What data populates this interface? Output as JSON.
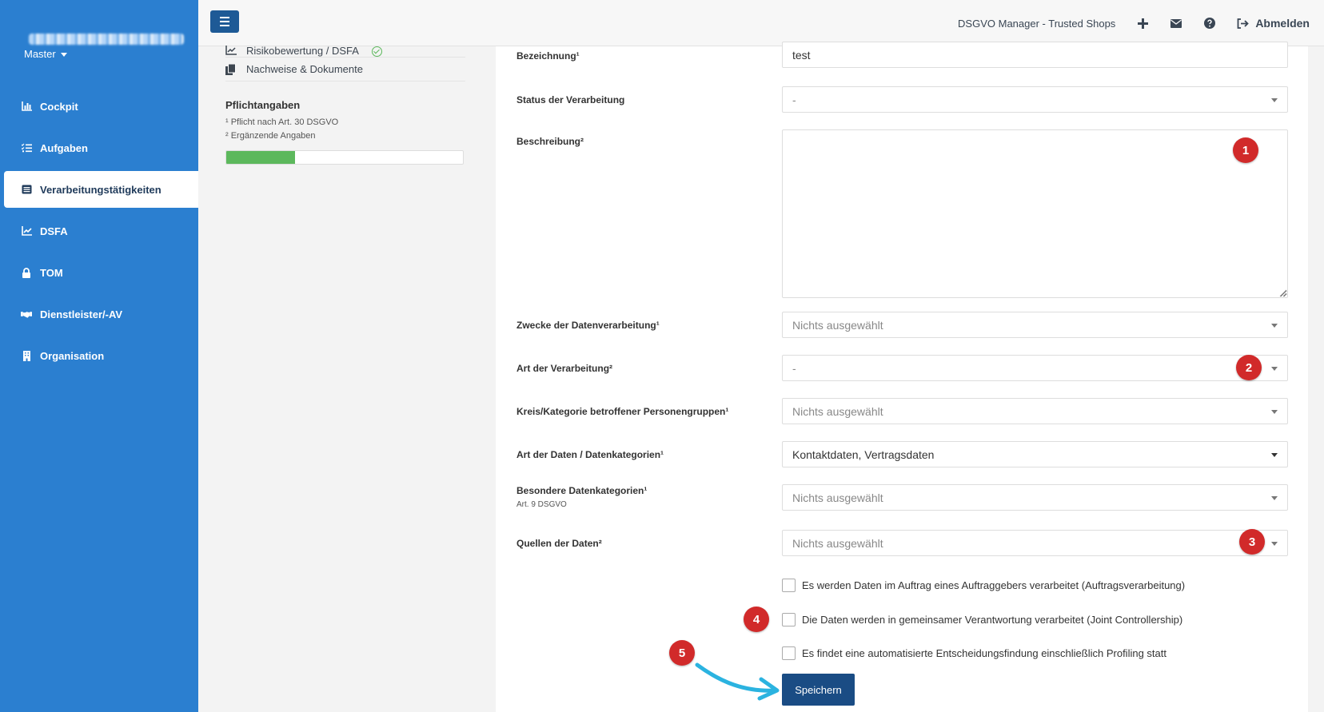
{
  "sidebar": {
    "account": "Master",
    "items": [
      {
        "label": "Cockpit",
        "icon": "chart-bar-icon"
      },
      {
        "label": "Aufgaben",
        "icon": "tasks-icon"
      },
      {
        "label": "Verarbeitungstätigkeiten",
        "icon": "list-alt-icon",
        "active": true
      },
      {
        "label": "DSFA",
        "icon": "chart-line-icon"
      },
      {
        "label": "TOM",
        "icon": "lock-icon"
      },
      {
        "label": "Dienstleister/-AV",
        "icon": "handshake-icon"
      },
      {
        "label": "Organisation",
        "icon": "building-icon"
      }
    ]
  },
  "topbar": {
    "app_title": "DSGVO Manager - Trusted Shops",
    "logout_label": "Abmelden"
  },
  "panel": {
    "items": [
      {
        "label": "Risikobewertung / DSFA",
        "icon": "chart-line-icon",
        "done": true
      },
      {
        "label": "Nachweise & Dokumente",
        "icon": "copy-icon"
      }
    ],
    "pflicht_title": "Pflichtangaben",
    "note1": "¹ Pflicht nach Art. 30 DSGVO",
    "note2": "² Ergänzende Angaben",
    "progress": 0.29
  },
  "form": {
    "bezeichnung": {
      "label": "Bezeichnung¹",
      "value": "test"
    },
    "status": {
      "label": "Status der Verarbeitung",
      "value": "-"
    },
    "beschreibung": {
      "label": "Beschreibung²",
      "value": ""
    },
    "zwecke": {
      "label": "Zwecke der Datenverarbeitung¹",
      "value": "Nichts ausgewählt"
    },
    "art_verarbeitung": {
      "label": "Art der Verarbeitung²",
      "value": "-"
    },
    "kreis": {
      "label": "Kreis/Kategorie betroffener Personengruppen¹",
      "value": "Nichts ausgewählt"
    },
    "art_daten": {
      "label": "Art der Daten / Datenkategorien¹",
      "value": "Kontaktdaten, Vertragsdaten"
    },
    "besondere": {
      "label": "Besondere Datenkategorien¹",
      "sublabel": "Art. 9 DSGVO",
      "value": "Nichts ausgewählt"
    },
    "quellen": {
      "label": "Quellen der Daten²",
      "value": "Nichts ausgewählt"
    },
    "checkboxes": [
      {
        "label": "Es werden Daten im Auftrag eines Auftraggebers verarbeitet (Auftragsverarbeitung)",
        "checked": false
      },
      {
        "label": "Die Daten werden in gemeinsamer Verantwortung verarbeitet (Joint Controllership)",
        "checked": false
      },
      {
        "label": "Es findet eine automatisierte Entscheidungsfindung einschließlich Profiling statt",
        "checked": false
      }
    ],
    "save_label": "Speichern"
  },
  "markers": [
    "1",
    "2",
    "3",
    "4",
    "5"
  ],
  "colors": {
    "sidebar": "#2b7fd0",
    "primary_button": "#1a4c84",
    "marker": "#d12a2a",
    "progress": "#5cb85c",
    "arrow": "#2bb3e0"
  }
}
